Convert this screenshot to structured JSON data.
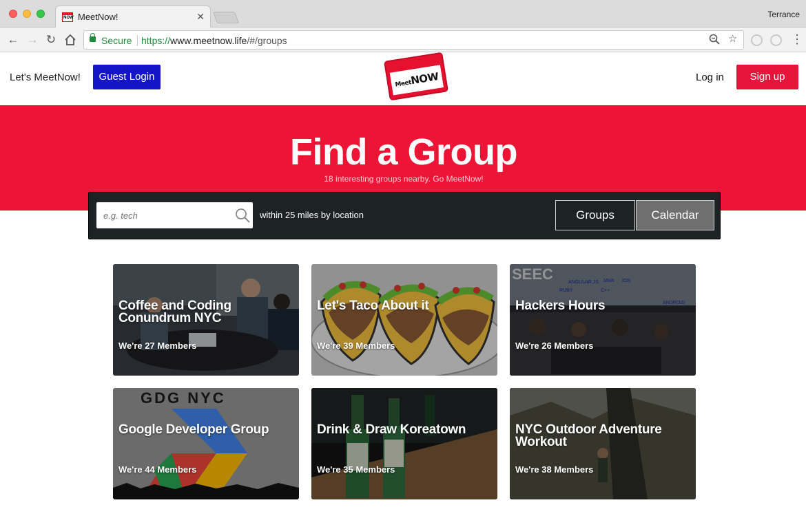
{
  "browser": {
    "tab_title": "MeetNow!",
    "tab_favicon_text": "NOW",
    "profile_name": "Terrance",
    "secure_label": "Secure",
    "url_scheme": "https://",
    "url_host": "www.meetnow.life",
    "url_path": "/#/groups"
  },
  "header": {
    "brand_text": "Let's MeetNow!",
    "guest_login_label": "Guest Login",
    "logo_text_small": "Meet",
    "logo_text_big": "NOW",
    "login_label": "Log in",
    "signup_label": "Sign up"
  },
  "hero": {
    "title": "Find a Group",
    "subtitle": "18 interesting groups nearby. Go MeetNow!"
  },
  "search": {
    "placeholder": "e.g. tech",
    "value": "",
    "radius_text": "within 25 miles by location",
    "groups_label": "Groups",
    "calendar_label": "Calendar"
  },
  "groups": [
    {
      "title": "Coffee and Coding Conundrum NYC",
      "members": "We're 27 Members"
    },
    {
      "title": "Let's Taco About it",
      "members": "We're 39 Members"
    },
    {
      "title": "Hackers Hours",
      "members": "We're 26 Members"
    },
    {
      "title": "Google Developer Group",
      "members": "We're 44 Members"
    },
    {
      "title": "Drink & Draw Koreatown",
      "members": "We're 35 Members"
    },
    {
      "title": "NYC Outdoor Adventure Workout",
      "members": "We're 38 Members"
    }
  ],
  "card_image_text": {
    "hackers_labels": [
      "ANGULAR.JS",
      "JAVA",
      "IOS",
      "RUBY",
      "C++",
      "ANDROID"
    ],
    "gdg_sign": "GDG NYC"
  },
  "colors": {
    "brand_red": "#ed1536",
    "signup_red": "#e8133b",
    "guest_blue": "#1414c8",
    "search_bar_bg": "#1d2225",
    "calendar_btn_bg": "#6f6f6f"
  }
}
